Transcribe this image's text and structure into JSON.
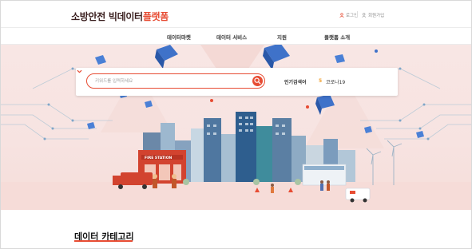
{
  "header": {
    "logo_text_main": "소방안전 빅데이터",
    "logo_text_accent": "플랫폼",
    "login_label": "로그인",
    "join_label": "회원가입"
  },
  "nav": {
    "items": [
      {
        "label": "데이터마켓"
      },
      {
        "label": "데이터 서비스"
      },
      {
        "label": "지원"
      },
      {
        "label": "플랫폼 소개"
      }
    ]
  },
  "hero": {
    "search": {
      "placeholder": "키워드를 입력하세요"
    },
    "popular": {
      "label": "인기검색어",
      "rank": "5",
      "term": "코로나19"
    },
    "illustration_sign": "FIRE STATION"
  },
  "section": {
    "title": "데이터 카테고리"
  },
  "colors": {
    "brand": "#e74c33",
    "logo_dark": "#3a1f1f",
    "hero_bg": "#f7e3e1",
    "rank": "#f0a030"
  },
  "icons": [
    "user-icon",
    "user-add-icon",
    "search-icon",
    "chevron-down-icon"
  ]
}
